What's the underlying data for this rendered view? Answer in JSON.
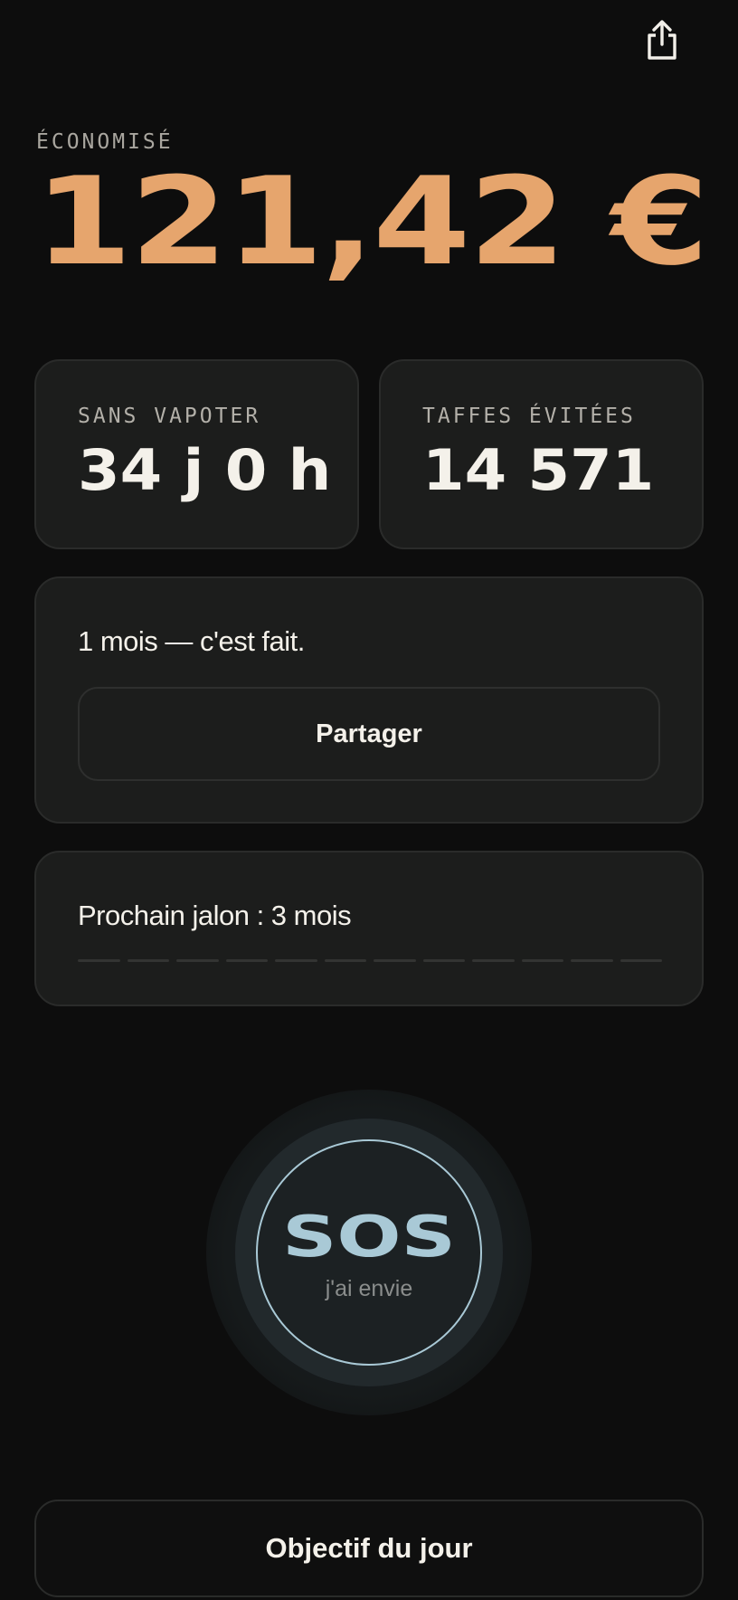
{
  "header": {
    "share_icon": "share-icon"
  },
  "savings": {
    "label": "ÉCONOMISÉ",
    "value": "121,42 €"
  },
  "stats": [
    {
      "label": "SANS VAPOTER",
      "value": "34 j 0 h"
    },
    {
      "label": "TAFFES ÉVITÉES",
      "value": "14 571"
    }
  ],
  "milestone": {
    "title": "1 mois — c'est fait.",
    "share_label": "Partager"
  },
  "next_milestone": {
    "title": "Prochain jalon : 3 mois",
    "segments_total": 12,
    "segments_filled": 0
  },
  "sos": {
    "label": "SOS",
    "sublabel": "j'ai envie"
  },
  "goal": {
    "label": "Objectif du jour"
  },
  "colors": {
    "background": "#0d0d0d",
    "accent": "#e6a56d",
    "sos": "#a9c9d6",
    "card": "#1c1d1c"
  }
}
